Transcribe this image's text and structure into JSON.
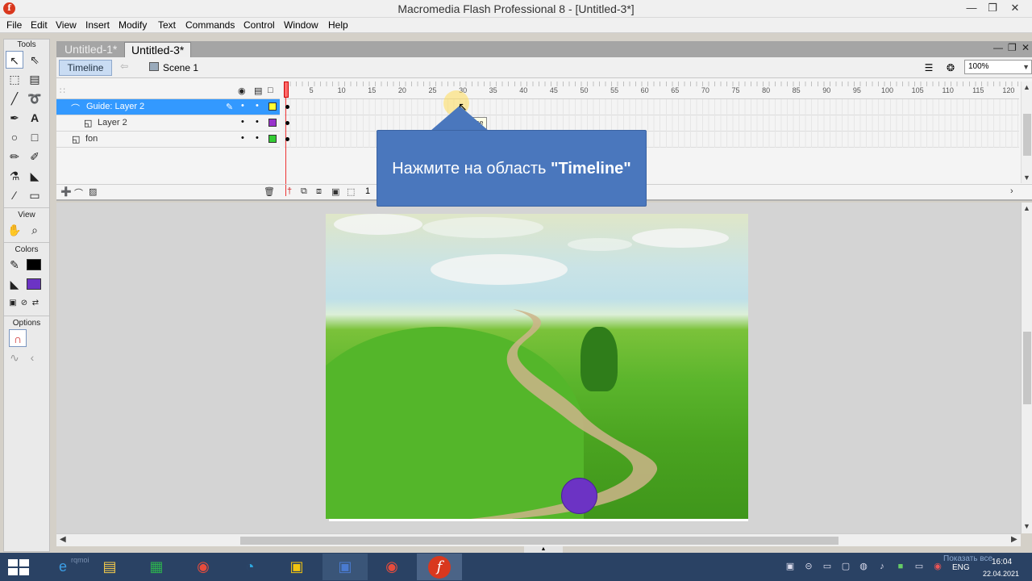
{
  "window": {
    "title": "Macromedia Flash Professional 8 - [Untitled-3*]",
    "app_icon": "f",
    "controls": {
      "minimize": "—",
      "restore": "❐",
      "close": "✕"
    }
  },
  "menu": [
    "File",
    "Edit",
    "View",
    "Insert",
    "Modify",
    "Text",
    "Commands",
    "Control",
    "Window",
    "Help"
  ],
  "tools_panel": {
    "title": "Tools",
    "view_label": "View",
    "colors_label": "Colors",
    "options_label": "Options",
    "colors": {
      "stroke": "#000000",
      "fill": "#6c33c4"
    }
  },
  "doc_tabs": [
    {
      "label": "Untitled-1*",
      "active": false
    },
    {
      "label": "Untitled-3*",
      "active": true
    }
  ],
  "doc_controls": {
    "minimize": "—",
    "restore": "❐",
    "close": "✕"
  },
  "editbar": {
    "timeline_button": "Timeline",
    "back_arrow": "⇦",
    "scene_label": "Scene 1",
    "zoom": "100%"
  },
  "timeline": {
    "layers": [
      {
        "name": "Guide: Layer 2",
        "type": "guide",
        "selected": true,
        "color": "#ffff33",
        "pencil": "✎"
      },
      {
        "name": "Layer 2",
        "type": "guided",
        "selected": false,
        "color": "#9933cc"
      },
      {
        "name": "fon",
        "type": "normal",
        "selected": false,
        "color": "#33cc33"
      }
    ],
    "ruler_ticks": [
      "5",
      "10",
      "15",
      "20",
      "25",
      "30",
      "35",
      "40",
      "45",
      "50",
      "55",
      "60",
      "65",
      "70",
      "75",
      "80",
      "85",
      "90",
      "95",
      "100",
      "105",
      "110",
      "115",
      "120"
    ],
    "current_frame": "1",
    "dot": "•"
  },
  "callout": {
    "text_before": "Нажмите на область ",
    "text_bold": "\"Timeline\"",
    "color": "#4a77bd"
  },
  "native_tooltip": "me",
  "taskbar": {
    "show_desktop": "Показать все",
    "language": "ENG",
    "time": "16:04",
    "date": "22.04.2021",
    "search_hint": "rqmoi"
  }
}
